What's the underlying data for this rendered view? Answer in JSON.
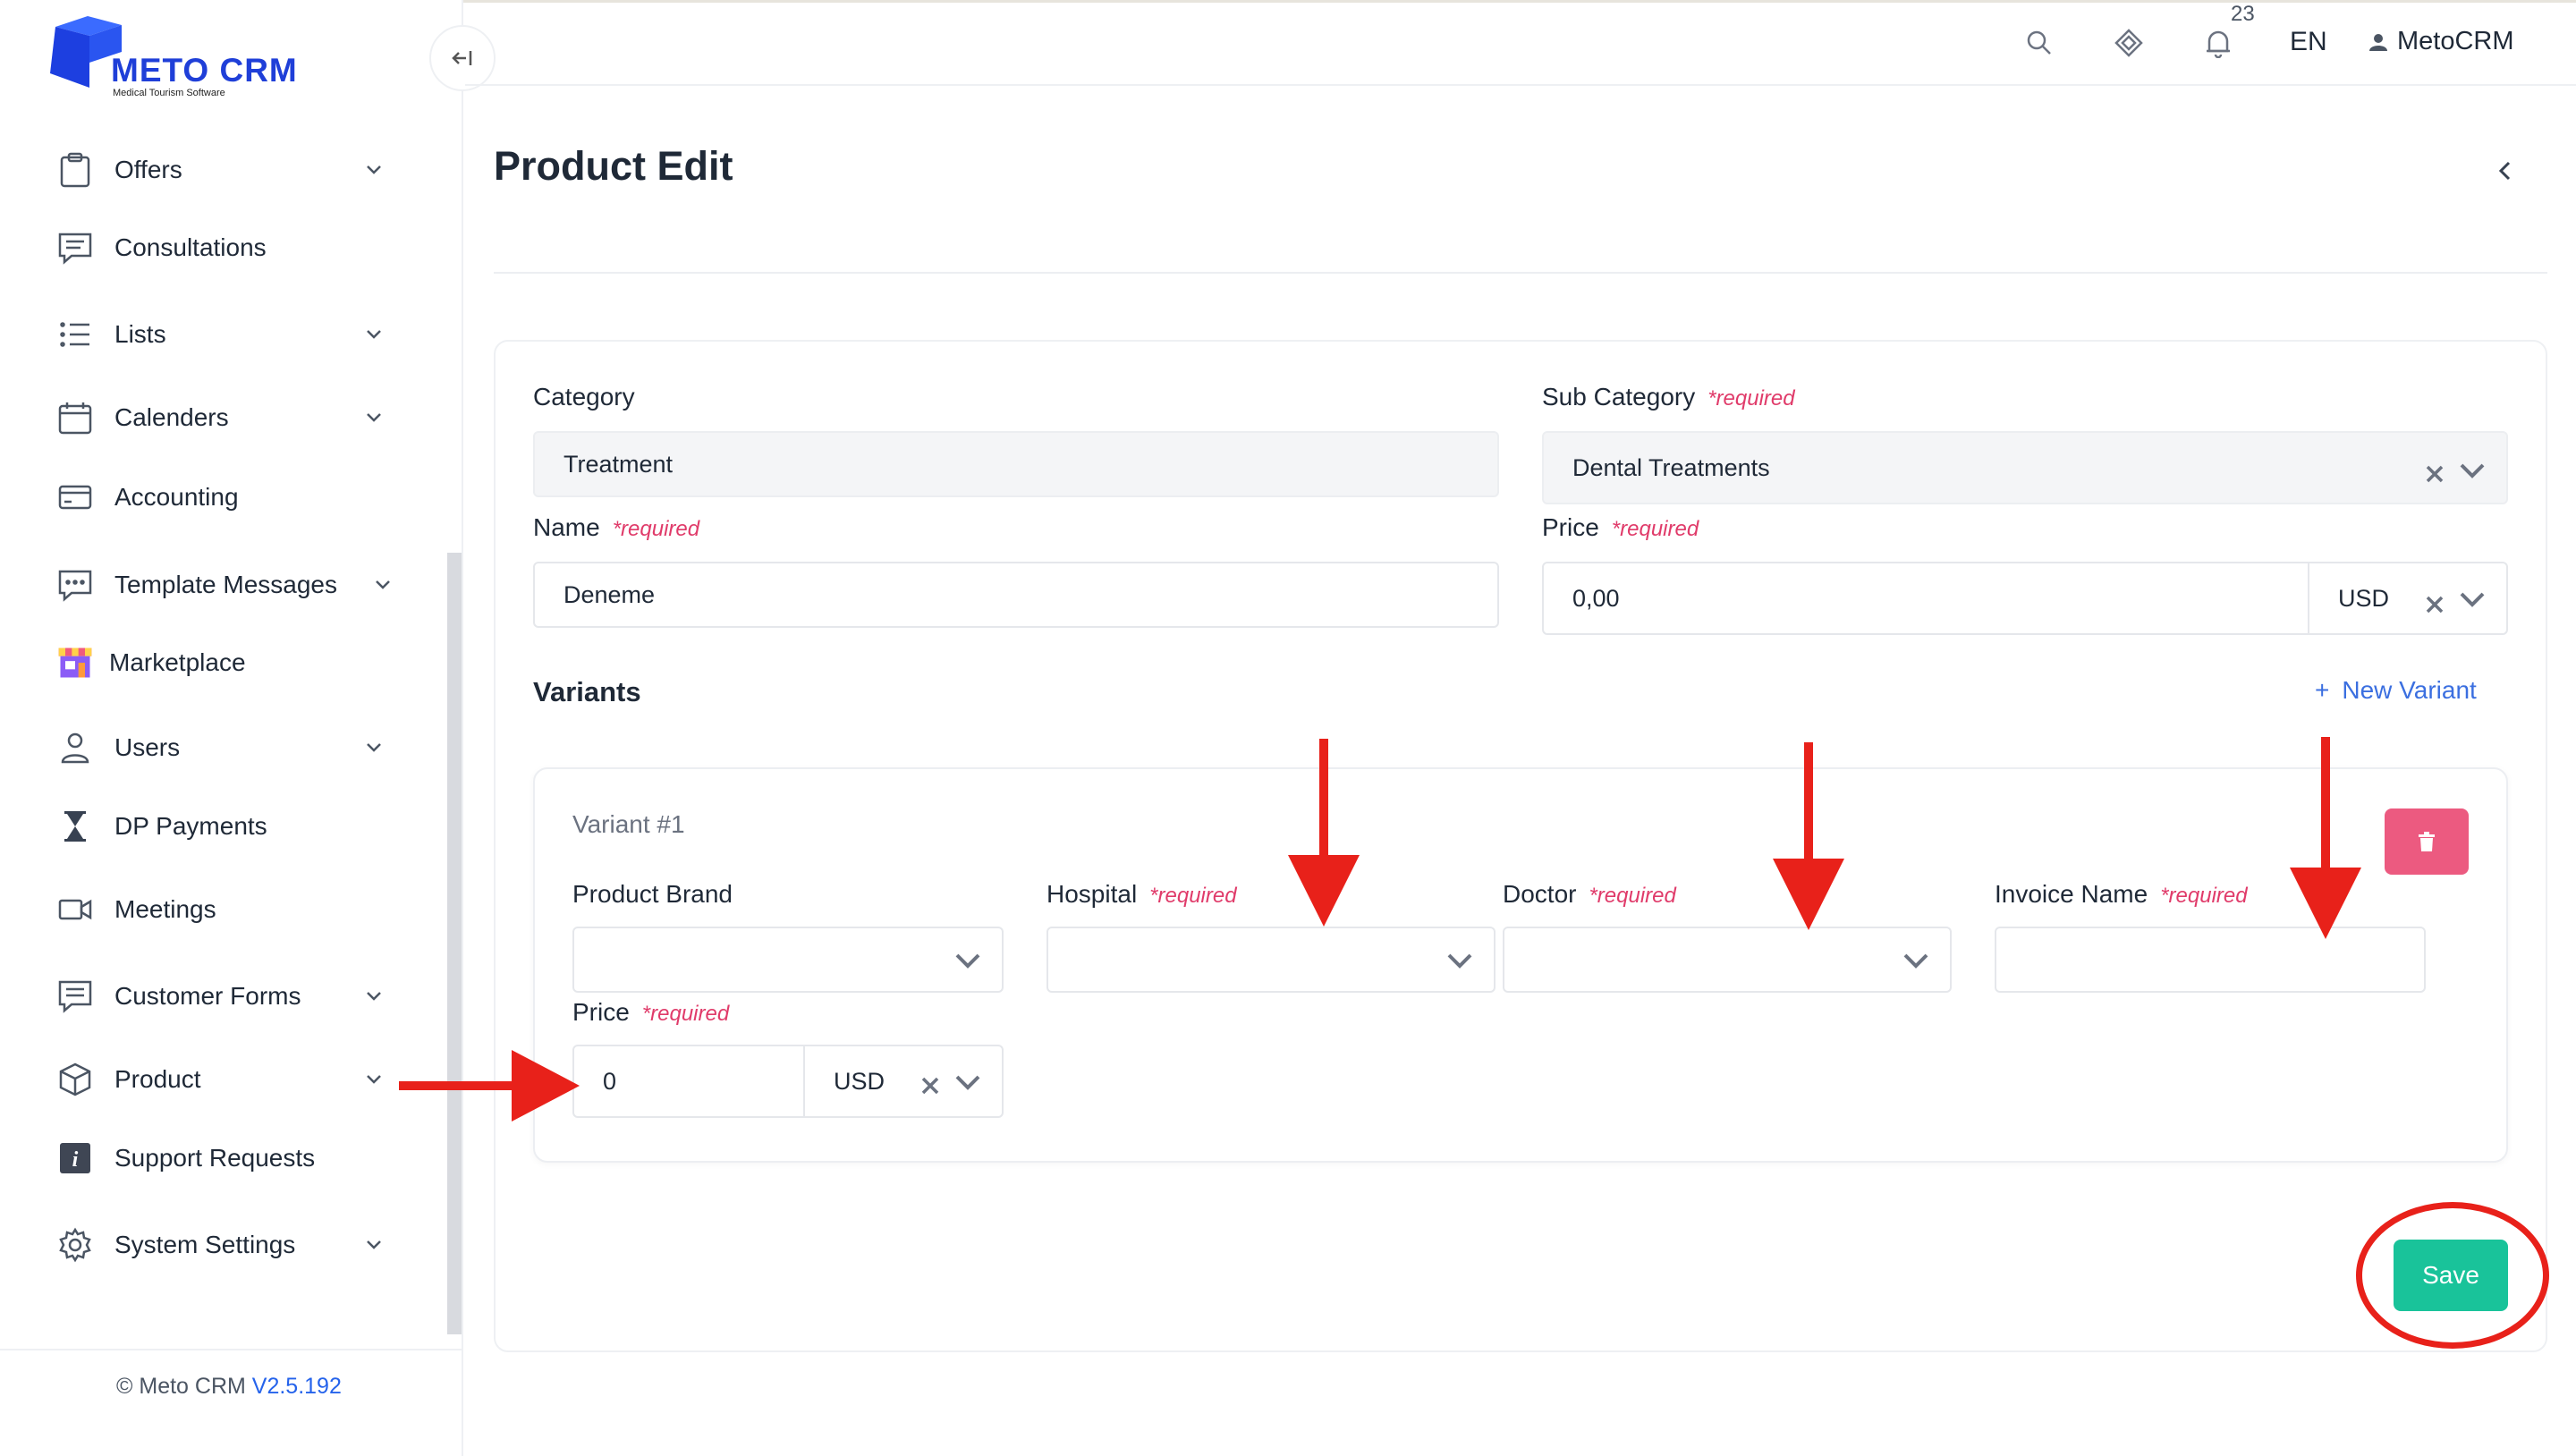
{
  "brand": {
    "name": "METO CRM",
    "tagline": "Medical Tourism Software"
  },
  "sidebar": {
    "items": [
      {
        "label": "Offers",
        "icon": "clipboard-icon",
        "has_submenu": true
      },
      {
        "label": "Consultations",
        "icon": "chat-lines-icon",
        "has_submenu": false
      },
      {
        "label": "Lists",
        "icon": "list-icon",
        "has_submenu": true
      },
      {
        "label": "Calenders",
        "icon": "calendar-icon",
        "has_submenu": true
      },
      {
        "label": "Accounting",
        "icon": "credit-card-icon",
        "has_submenu": false
      },
      {
        "label": "Template Messages",
        "icon": "message-dots-icon",
        "has_submenu": true
      },
      {
        "label": "Marketplace",
        "icon": "store-icon",
        "has_submenu": false
      },
      {
        "label": "Users",
        "icon": "user-icon",
        "has_submenu": true
      },
      {
        "label": "DP Payments",
        "icon": "hourglass-icon",
        "has_submenu": false
      },
      {
        "label": "Meetings",
        "icon": "video-camera-icon",
        "has_submenu": false
      },
      {
        "label": "Customer Forms",
        "icon": "form-icon",
        "has_submenu": true
      },
      {
        "label": "Product",
        "icon": "cube-icon",
        "has_submenu": true
      },
      {
        "label": "Support Requests",
        "icon": "info-icon",
        "has_submenu": false
      },
      {
        "label": "System Settings",
        "icon": "gear-icon",
        "has_submenu": true
      }
    ],
    "footer_prefix": "© Meto CRM",
    "version": "V2.5.192"
  },
  "header": {
    "notification_count": "23",
    "language": "EN",
    "user_name": "MetoCRM"
  },
  "page": {
    "title": "Product Edit"
  },
  "form": {
    "required_text": "*required",
    "category": {
      "label": "Category",
      "value": "Treatment"
    },
    "sub_category": {
      "label": "Sub Category",
      "value": "Dental Treatments"
    },
    "name": {
      "label": "Name",
      "value": "Deneme"
    },
    "price": {
      "label": "Price",
      "value": "0,00",
      "currency": "USD"
    },
    "variants_title": "Variants",
    "new_variant_label": "New Variant",
    "new_variant_icon": "+",
    "variant": {
      "title": "Variant #1",
      "product_brand_label": "Product Brand",
      "hospital_label": "Hospital",
      "doctor_label": "Doctor",
      "invoice_name_label": "Invoice Name",
      "price_label": "Price",
      "price_value": "0",
      "price_currency": "USD"
    },
    "save_label": "Save"
  },
  "colors": {
    "accent_blue": "#1f3fd8",
    "required_pink": "#e03b6a",
    "save_green": "#19c39a",
    "delete_pink": "#ec5a80",
    "annotation_red": "#e8211a"
  }
}
